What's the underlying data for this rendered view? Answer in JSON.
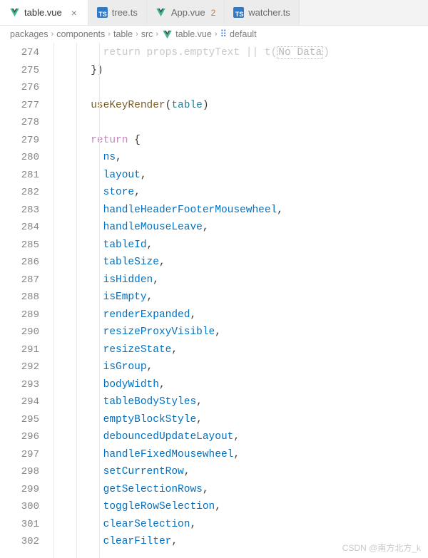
{
  "tabs": [
    {
      "label": "table.vue",
      "type": "vue",
      "active": true,
      "closable": true
    },
    {
      "label": "tree.ts",
      "type": "ts",
      "active": false
    },
    {
      "label": "App.vue",
      "type": "vue",
      "active": false,
      "modified": "2"
    },
    {
      "label": "watcher.ts",
      "type": "ts",
      "active": false
    }
  ],
  "breadcrumb": {
    "items": [
      "packages",
      "components",
      "table",
      "src",
      "table.vue",
      "default"
    ],
    "fileIndex": 4,
    "symbolIndex": 5
  },
  "lines": [
    {
      "n": 274,
      "tokens": [
        [
          "        ",
          ""
        ],
        [
          "return ",
          "tk-faded"
        ],
        [
          "props.emptyText || t(",
          "tk-faded"
        ],
        [
          "No Data",
          "tk-faded-box"
        ],
        [
          ")",
          "tk-faded"
        ]
      ]
    },
    {
      "n": 275,
      "tokens": [
        [
          "      ",
          ""
        ],
        [
          "})",
          "tk-punct"
        ]
      ]
    },
    {
      "n": 276,
      "tokens": []
    },
    {
      "n": 277,
      "tokens": [
        [
          "      ",
          ""
        ],
        [
          "useKeyRender",
          "tk-func"
        ],
        [
          "(",
          "tk-punct"
        ],
        [
          "table",
          "tk-param"
        ],
        [
          ")",
          "tk-punct"
        ]
      ]
    },
    {
      "n": 278,
      "tokens": []
    },
    {
      "n": 279,
      "tokens": [
        [
          "      ",
          ""
        ],
        [
          "return",
          "tk-keyword"
        ],
        [
          " {",
          "tk-punct"
        ]
      ]
    },
    {
      "n": 280,
      "tokens": [
        [
          "        ",
          ""
        ],
        [
          "ns",
          "tk-var"
        ],
        [
          ",",
          "tk-punct"
        ]
      ]
    },
    {
      "n": 281,
      "tokens": [
        [
          "        ",
          ""
        ],
        [
          "layout",
          "tk-var"
        ],
        [
          ",",
          "tk-punct"
        ]
      ]
    },
    {
      "n": 282,
      "tokens": [
        [
          "        ",
          ""
        ],
        [
          "store",
          "tk-var"
        ],
        [
          ",",
          "tk-punct"
        ]
      ]
    },
    {
      "n": 283,
      "tokens": [
        [
          "        ",
          ""
        ],
        [
          "handleHeaderFooterMousewheel",
          "tk-var"
        ],
        [
          ",",
          "tk-punct"
        ]
      ]
    },
    {
      "n": 284,
      "tokens": [
        [
          "        ",
          ""
        ],
        [
          "handleMouseLeave",
          "tk-var"
        ],
        [
          ",",
          "tk-punct"
        ]
      ]
    },
    {
      "n": 285,
      "tokens": [
        [
          "        ",
          ""
        ],
        [
          "tableId",
          "tk-var"
        ],
        [
          ",",
          "tk-punct"
        ]
      ]
    },
    {
      "n": 286,
      "tokens": [
        [
          "        ",
          ""
        ],
        [
          "tableSize",
          "tk-var"
        ],
        [
          ",",
          "tk-punct"
        ]
      ]
    },
    {
      "n": 287,
      "tokens": [
        [
          "        ",
          ""
        ],
        [
          "isHidden",
          "tk-var"
        ],
        [
          ",",
          "tk-punct"
        ]
      ]
    },
    {
      "n": 288,
      "tokens": [
        [
          "        ",
          ""
        ],
        [
          "isEmpty",
          "tk-var"
        ],
        [
          ",",
          "tk-punct"
        ]
      ]
    },
    {
      "n": 289,
      "tokens": [
        [
          "        ",
          ""
        ],
        [
          "renderExpanded",
          "tk-var"
        ],
        [
          ",",
          "tk-punct"
        ]
      ]
    },
    {
      "n": 290,
      "tokens": [
        [
          "        ",
          ""
        ],
        [
          "resizeProxyVisible",
          "tk-var"
        ],
        [
          ",",
          "tk-punct"
        ]
      ]
    },
    {
      "n": 291,
      "tokens": [
        [
          "        ",
          ""
        ],
        [
          "resizeState",
          "tk-var"
        ],
        [
          ",",
          "tk-punct"
        ]
      ]
    },
    {
      "n": 292,
      "tokens": [
        [
          "        ",
          ""
        ],
        [
          "isGroup",
          "tk-var"
        ],
        [
          ",",
          "tk-punct"
        ]
      ]
    },
    {
      "n": 293,
      "tokens": [
        [
          "        ",
          ""
        ],
        [
          "bodyWidth",
          "tk-var"
        ],
        [
          ",",
          "tk-punct"
        ]
      ]
    },
    {
      "n": 294,
      "tokens": [
        [
          "        ",
          ""
        ],
        [
          "tableBodyStyles",
          "tk-var"
        ],
        [
          ",",
          "tk-punct"
        ]
      ]
    },
    {
      "n": 295,
      "tokens": [
        [
          "        ",
          ""
        ],
        [
          "emptyBlockStyle",
          "tk-var"
        ],
        [
          ",",
          "tk-punct"
        ]
      ]
    },
    {
      "n": 296,
      "tokens": [
        [
          "        ",
          ""
        ],
        [
          "debouncedUpdateLayout",
          "tk-var"
        ],
        [
          ",",
          "tk-punct"
        ]
      ]
    },
    {
      "n": 297,
      "tokens": [
        [
          "        ",
          ""
        ],
        [
          "handleFixedMousewheel",
          "tk-var"
        ],
        [
          ",",
          "tk-punct"
        ]
      ]
    },
    {
      "n": 298,
      "tokens": [
        [
          "        ",
          ""
        ],
        [
          "setCurrentRow",
          "tk-var"
        ],
        [
          ",",
          "tk-punct"
        ]
      ]
    },
    {
      "n": 299,
      "tokens": [
        [
          "        ",
          ""
        ],
        [
          "getSelectionRows",
          "tk-var"
        ],
        [
          ",",
          "tk-punct"
        ]
      ]
    },
    {
      "n": 300,
      "tokens": [
        [
          "        ",
          ""
        ],
        [
          "toggleRowSelection",
          "tk-var"
        ],
        [
          ",",
          "tk-punct"
        ]
      ]
    },
    {
      "n": 301,
      "tokens": [
        [
          "        ",
          ""
        ],
        [
          "clearSelection",
          "tk-var"
        ],
        [
          ",",
          "tk-punct"
        ]
      ]
    },
    {
      "n": 302,
      "tokens": [
        [
          "        ",
          ""
        ],
        [
          "clearFilter",
          "tk-var"
        ],
        [
          ",",
          "tk-punct"
        ]
      ]
    }
  ],
  "watermark": "CSDN @南方北方_k"
}
